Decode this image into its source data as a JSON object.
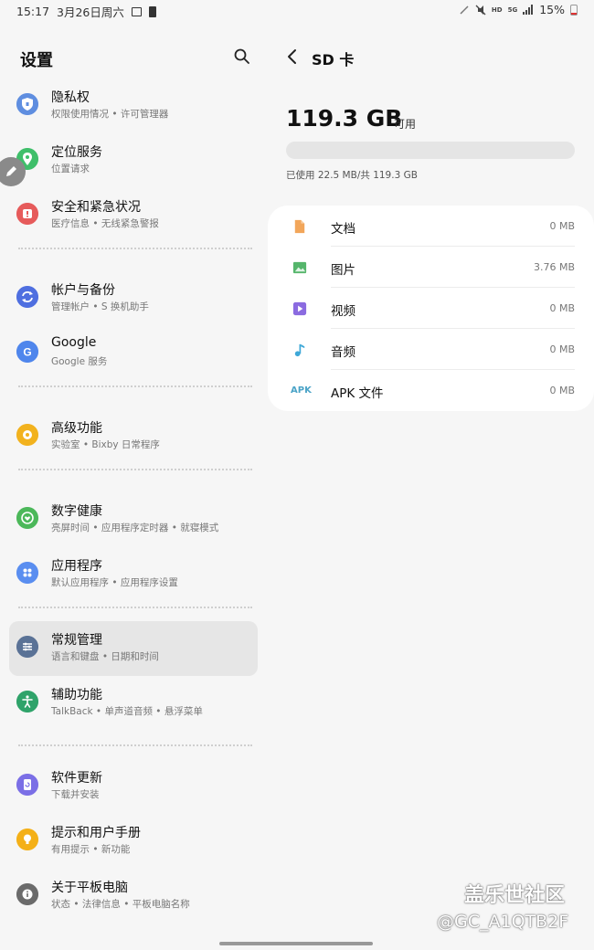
{
  "status_bar": {
    "time": "15:17",
    "date": "3月26日周六",
    "network": "5G",
    "hd": "HD",
    "battery": "15%"
  },
  "settings": {
    "title": "设置",
    "items": [
      {
        "title": "隐私权",
        "subtitle": "权限使用情况 • 许可管理器",
        "icon": "shield-icon",
        "color": "#5f8ee0"
      },
      {
        "title": "定位服务",
        "subtitle": "位置请求",
        "icon": "location-icon",
        "color": "#3fbf6a"
      },
      {
        "title": "安全和紧急状况",
        "subtitle": "医疗信息 • 无线紧急警报",
        "icon": "emergency-icon",
        "color": "#e65b5b"
      },
      {
        "title": "帐户与备份",
        "subtitle": "管理帐户 • S 换机助手",
        "icon": "sync-icon",
        "color": "#4f6fe0"
      },
      {
        "title": "Google",
        "subtitle": "Google 服务",
        "icon": "google-icon",
        "color": "#4f86ec"
      },
      {
        "title": "高级功能",
        "subtitle": "实验室 • Bixby 日常程序",
        "icon": "gear-plus-icon",
        "color": "#f2b21e"
      },
      {
        "title": "数字健康",
        "subtitle": "亮屏时间 • 应用程序定时器 • 就寝模式",
        "icon": "heart-icon",
        "color": "#4cb85a"
      },
      {
        "title": "应用程序",
        "subtitle": "默认应用程序 • 应用程序设置",
        "icon": "apps-icon",
        "color": "#5a8ef0"
      },
      {
        "title": "常规管理",
        "subtitle": "语言和键盘 • 日期和时间",
        "icon": "sliders-icon",
        "color": "#5a7296"
      },
      {
        "title": "辅助功能",
        "subtitle": "TalkBack • 单声道音频 • 悬浮菜单",
        "icon": "accessibility-icon",
        "color": "#2fa36a"
      },
      {
        "title": "软件更新",
        "subtitle": "下载并安装",
        "icon": "update-icon",
        "color": "#7b6fe6"
      },
      {
        "title": "提示和用户手册",
        "subtitle": "有用提示 • 新功能",
        "icon": "bulb-icon",
        "color": "#f4b018"
      },
      {
        "title": "关于平板电脑",
        "subtitle": "状态 • 法律信息 • 平板电脑名称",
        "icon": "info-icon",
        "color": "#6b6b6b"
      }
    ]
  },
  "sd_card": {
    "title": "SD 卡",
    "available": "119.3 GB",
    "available_label": "可用",
    "used_text": "已使用 22.5 MB/共 119.3 GB",
    "used_fraction": 0.0002,
    "categories": [
      {
        "label": "文档",
        "size": "0 MB",
        "icon": "document-icon",
        "color": "#f2a65a"
      },
      {
        "label": "图片",
        "size": "3.76 MB",
        "icon": "image-icon",
        "color": "#55b56b"
      },
      {
        "label": "视频",
        "size": "0 MB",
        "icon": "video-icon",
        "color": "#8b6be0"
      },
      {
        "label": "音频",
        "size": "0 MB",
        "icon": "music-icon",
        "color": "#3ea8d8"
      },
      {
        "label": "APK 文件",
        "size": "0 MB",
        "icon": "apk-icon",
        "icon_text": "APK",
        "color": "#4aa3c7"
      }
    ]
  },
  "watermark": {
    "line1": "盖乐世社区",
    "line2": "@GC_A1QTB2F"
  }
}
